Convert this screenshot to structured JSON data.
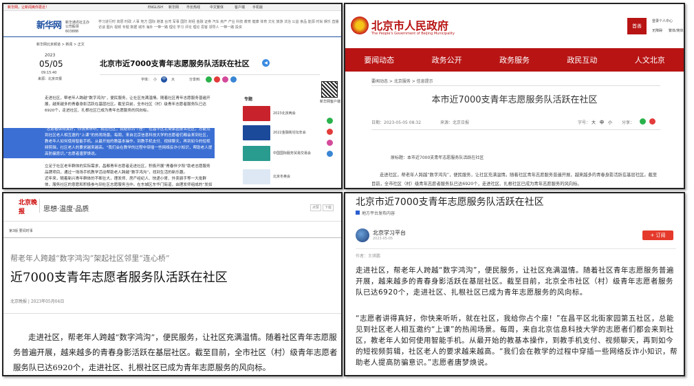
{
  "panel1": {
    "top_left": "新华网，让新闻离你更近！",
    "top_right_items": [
      "ENGLISH",
      "新华网",
      "市长热线",
      "中文繁体",
      "客户端",
      "手机版"
    ],
    "logo_text": "新华网",
    "logo_sub": "新华通讯社主办 公司股票 603888",
    "breadcrumb": "新华网北京频道 > 新闻 > 正文",
    "year": "2023",
    "date": "05/05",
    "time": "09:15:40",
    "source": "来源：北京日报",
    "title": "北京市近7000支青年志愿服务队活跃在社区",
    "font_label": "字体：",
    "font_sizes": [
      "小",
      "中",
      "大"
    ],
    "share_label": "分享到:",
    "paragraphs": [
      "走进社区，帮老年人跨越“数字鸿沟”，便民服务，让社区充满温情。随着社区青年志愿服务普遍开展，越来越多的青春身影活跃在基层社区。截至目前，全市社区（村）级青年志愿者服务队已达6920个，走进社区、扎根社区已成为青年志愿服务的风向标。",
      "“志愿者讲得真好，你快来听听，就在社区，我给你占个座！”在昌平区北街家园第五社区，总能见到社区老人相互邀约“上课”的热闹场景。每周，来自北京信息科技大学的志愿者们都会来到社区，教老年人如何使用智能手机。从最开始的教基本操作，到教手机支付、视频聊天，再到如今的短视频剪辑，社区老人的要求越来越高。“我们会在教学的过程中穿插一些网络反诈小知识，帮助老人提高防骗意识。”志愿者唐梦焕说。",
      "立足于社区老年群体的实际需求，昌都青年志愿者走进社区，积极开展“青春伴夕阳”助老志愿服务品牌项目，通过一场场手机教学活动帮助老人跨越“数字鸿沟”，找到生活的新乐趣。",
      "近年来，随着新兴青年群体的不断壮大，理发师、房产经纪人、快递小哥、外卖骑手等一大批群体，服务社区的意愿和积极参与到社区志愿服务当中。在东城区东华门街道，由理发师组成的“发如巧人”志愿"
    ],
    "special_label": "专题",
    "side_items": [
      "2023北京两会",
      "2022金融街论坛年会",
      "中国国际服务贸易交易会",
      "北京冬奥会"
    ],
    "qr_label": "新华网客户端"
  },
  "panel2": {
    "site_name": "北京市人民政府",
    "site_en": "The People's Government of Beijing Municipality",
    "right_top": [
      "登录个人中心",
      "无障碍",
      "繁体/简体"
    ],
    "nav": [
      "要闻动态",
      "政务公开",
      "政务服务",
      "政民互动",
      "人文北京"
    ],
    "breadcrumb": "要闻动态 > 北京服务 > 信息提示",
    "title": "本市近7000支青年志愿服务队活跃在社区",
    "meta_date": "日期：2023-05-05 08:32",
    "meta_source": "来源：北京日报",
    "font_label": "字号：",
    "font_sizes": [
      "大",
      "中",
      "小"
    ],
    "share_label": "分享：",
    "original_title": "原标题：本市近7000支青年志愿服务队活跃在社区",
    "paragraph": "走进社区，帮老年人跨越“数字鸿沟”，便民服务，让社区充满温情。随着社区青年志愿服务普遍开展，越来越多的青春身影活跃在基层社区。截至目前，全市社区（村）级青年志愿者服务队已达6920个，走进社区、扎根社区已成为青年志愿服务的风向标。"
  },
  "panel3": {
    "logo": "北京晚报",
    "slogan": "思想·温度·品质",
    "btn1": "点赞",
    "btn2": "下载",
    "section": "第3版  要闻时事",
    "subtitle": "帮老年人跨越“数字鸿沟”架起社区邻里“连心桥”",
    "title": "近7000支青年志愿者服务队活跃在社区",
    "meta": "北京晚报 | 2023年05月04日",
    "paragraph": "走进社区，帮老年人跨越“数字鸿沟”，便民服务，让社区充满温情。随着社区青年志愿服务普遍开展，越来越多的青春身影活跃在基层社区。截至目前，全市社区（村）级青年志愿者服务队已达6920个，走进社区、扎根社区已成为青年志愿服务的风向标。"
  },
  "panel4": {
    "title": "北京市近7000支青年志愿服务队活跃在社区",
    "tag": "地方平台发布内容",
    "author": "北京学习平台",
    "date": "2023-05-05",
    "subscribe": "+ 订阅",
    "editor": "作者：王琪鹏",
    "paragraph1": "走进社区，帮老年人跨越“数字鸿沟”，便民服务，让社区充满温情。随着社区青年志愿服务普遍开展，越来越多的青春身影活跃在基层社区。截至目前，北京全市社区（村）级青年志愿者服务队已达6920个，走进社区、扎根社区已成为青年志愿服务的风向标。",
    "paragraph2": "“志愿者讲得真好，你快来听听，就在社区，我给你占个座！”在昌平区北街家园第五社区，总能见到社区老人相互邀约“上课”的热闹场景。每周，来自北京信息科技大学的志愿者们都会来到社区，教老年人如何使用智能手机。从最开始的教基本操作，到教手机支付、视频聊天，再到如今的短视频剪辑，社区老人的要求越来越高。“我们会在教学的过程中穿插一些网络反诈小知识，帮助老人提高防骗意识。”志愿者唐梦焕说。"
  },
  "colors": {
    "xinhua_blue": "#1e50a2",
    "gov_red": "#b81414",
    "highlight": "#3b6fd3",
    "subscribe_red": "#e53a2b"
  }
}
